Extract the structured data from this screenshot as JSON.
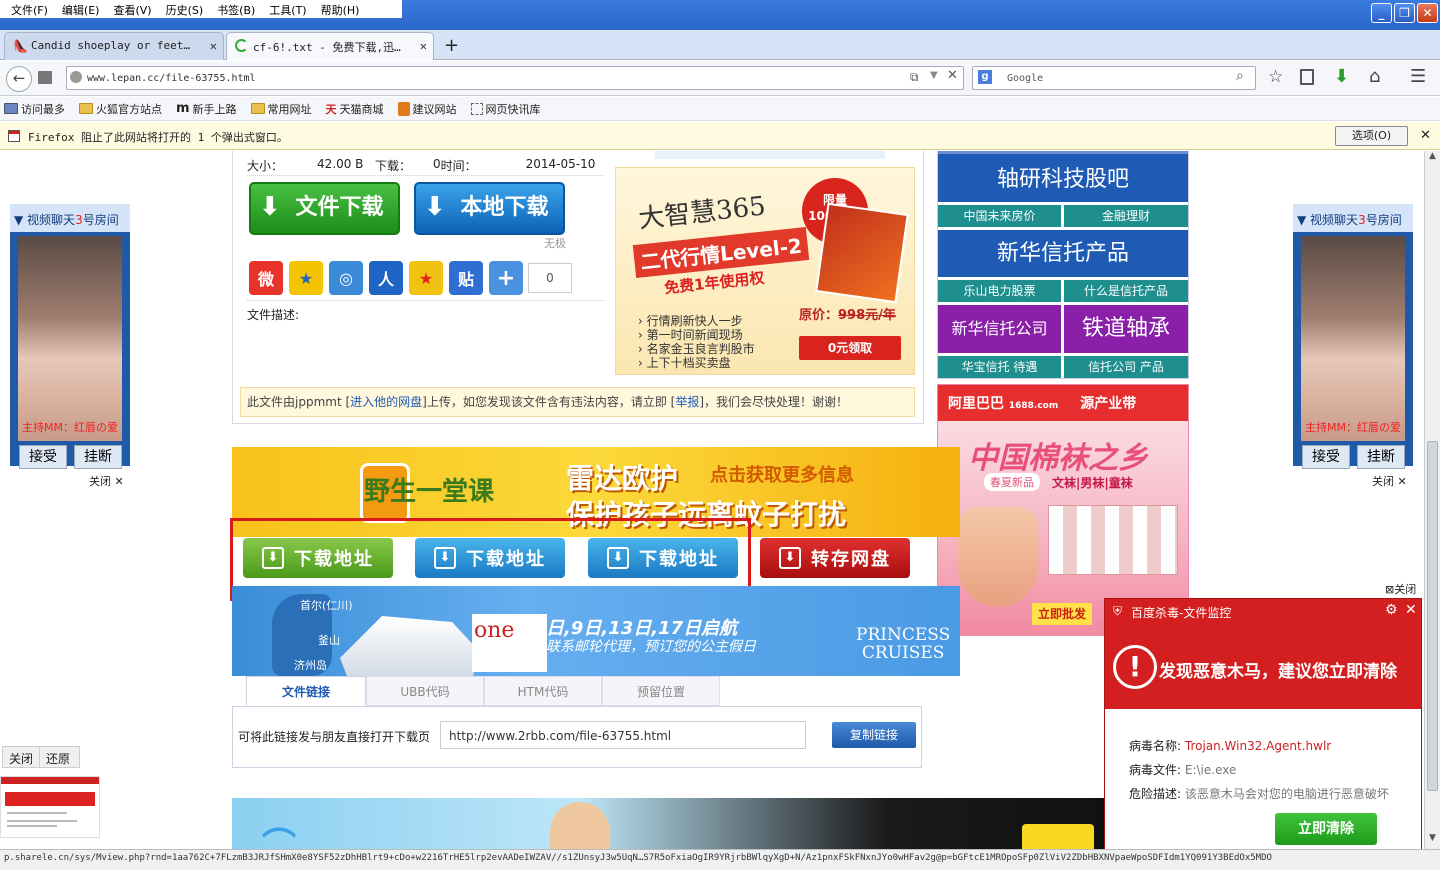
{
  "menu": [
    "文件(F)",
    "编辑(E)",
    "查看(V)",
    "历史(S)",
    "书签(B)",
    "工具(T)",
    "帮助(H)"
  ],
  "tabs": [
    {
      "label": "Candid shoeplay or feet…"
    },
    {
      "label": "cf-6!.txt - 免费下载,迅…"
    }
  ],
  "nav": {
    "url": "www.lepan.cc/file-63755.html",
    "search_placeholder": "Google"
  },
  "bookmarks": [
    "访问最多",
    "火狐官方站点",
    "新手上路",
    "常用网址",
    "天猫商城",
    "建议网站",
    "网页快讯库"
  ],
  "popup_bar": {
    "message": "Firefox 阻止了此网站将打开的 1 个弹出式窗口。",
    "options_label": "选项(O)"
  },
  "file_info": {
    "size_label": "大小：",
    "size_value": "42.00 B",
    "downloads_label": "下载：",
    "downloads_value": "0",
    "time_label": "时间：",
    "time_value": "2014-05-10",
    "btn_file_download": "文件下载",
    "btn_local_download": "本地下载",
    "unlimited": "无极",
    "share_count": "0",
    "desc_label": "文件描述:"
  },
  "notice": {
    "pre": "此文件由jppmmt [",
    "link1": "进入他的网盘",
    "mid": "]上传，如您发现该文件含有违法内容，请立即 [",
    "link2": "举报",
    "post": "]，我们会尽快处理！谢谢！"
  },
  "ad_dazhihui": {
    "title": "大智慧365",
    "badge": "限量\n10000套",
    "sub": "二代行情Level-2",
    "free": "免费1年使用权",
    "price_label": "原价：",
    "price": "998元/年",
    "bullets": [
      "行情刷新快人一步",
      "第一时间新闻现场",
      "名家金玉良言判股市",
      "上下十档买卖盘"
    ],
    "cta": "0元领取"
  },
  "right_links": [
    {
      "text": "轴研科技股吧",
      "big": true
    },
    {
      "text": "中国未来房价",
      "text2": "金融理财"
    },
    {
      "text": "新华信托产品",
      "big": true
    },
    {
      "text": "乐山电力股票",
      "text2": "什么是信托产品"
    },
    {
      "text": "新华信托公司",
      "text2": "铁道轴承"
    },
    {
      "text": "华宝信托 待遇",
      "text2": "信托公司 产品"
    }
  ],
  "ad_yeke": {
    "logo": "野生一堂课",
    "line1": "雷达欧护",
    "line2": "保护孩子远离蚊子打扰",
    "cta": "点击获取更多信息"
  },
  "download_buttons": [
    "下载地址",
    "下载地址",
    "下载地址",
    "转存网盘"
  ],
  "ad_cruise": {
    "places": [
      "首尔(仁川)",
      "釜山",
      "济州岛"
    ],
    "line1": "日,9日,13日,17日启航",
    "line2": "联系邮轮代理，预订您的公主假日",
    "brand1": "PRINCESS",
    "brand2": "CRUISES",
    "one": "one"
  },
  "ad_1688": {
    "brand": "阿里巴巴",
    "sub": "1688.com",
    "brand2": "源产业带",
    "title": "中国棉袜之乡",
    "new": "春夏新品",
    "cats": "文袜|男袜|童袜",
    "cta": "立即批发",
    "close": "关闭"
  },
  "link_tabs": [
    "文件链接",
    "UBB代码",
    "HTM代码",
    "预留位置"
  ],
  "link_row": {
    "label": "可将此链接发与朋友直接打开下载页",
    "value": "http://www.2rbb.com/file-63755.html",
    "copy": "复制链接"
  },
  "side_ad": {
    "title_pre": "视频聊天",
    "room_num": "3",
    "title_post": "号房间",
    "host": "主持MM：红唇の爱",
    "accept": "接受",
    "hangup": "挂断",
    "close": "关闭"
  },
  "mini_panel": {
    "close": "关闭",
    "restore": "还原"
  },
  "antivirus": {
    "title": "百度杀毒-文件监控",
    "headline": "发现恶意木马，建议您立即清除",
    "name_label": "病毒名称:",
    "name_value": "Trojan.Win32.Agent.hwlr",
    "file_label": "病毒文件:",
    "file_value": "E:\\ie.exe",
    "desc_label": "危险描述:",
    "desc_value": "该恶意木马会对您的电脑进行恶意破坏",
    "button": "立即清除"
  },
  "status_url": "p.sharele.cn/sys/Mview.php?rnd=1aa762C+7FLzmB3JRJfSHmX0e8YSF52zDhHBlrt9+cDo+w2216TrHE5lrp2evAADeIWZAV//s1ZUnsyJ3w5UqN…S7R5oFxiaOgIR9YRjrbBWlqyXgD+N/Az1pnxFSkFNxnJYo0wHFav2g@p=bGFtcE1MROpoSFp0ZlViV2ZDbHBXNVpaeWpoSDFIdm1YQ091Y3BEdOx5MDO",
  "colors": {
    "accent_red": "#cc1a1a",
    "link_blue": "#1f5bb5",
    "green": "#1d8d18"
  }
}
